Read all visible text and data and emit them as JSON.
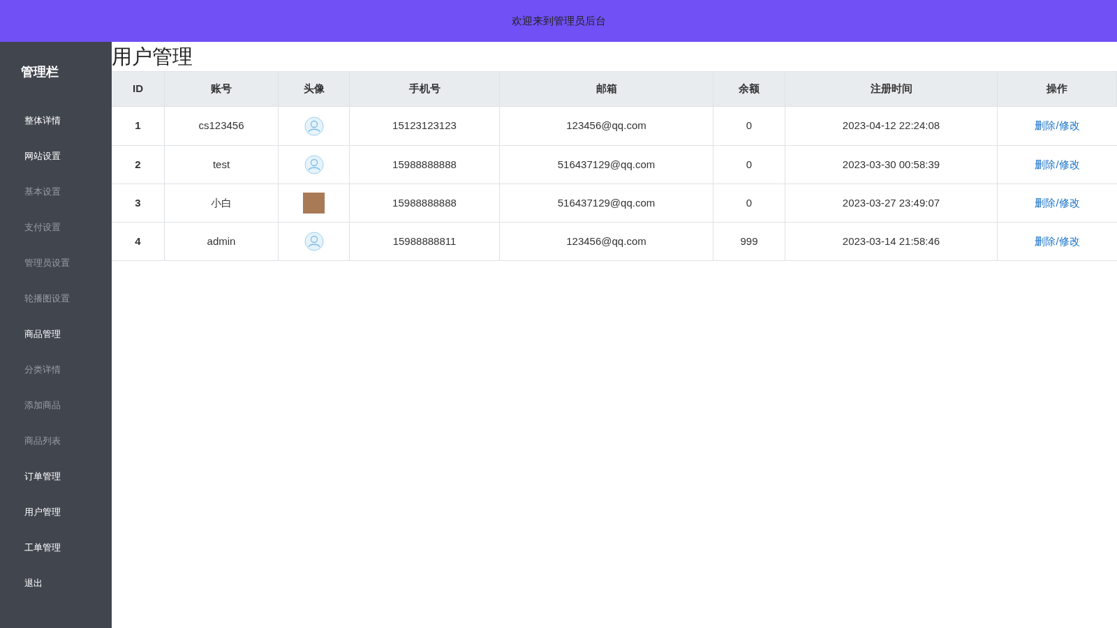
{
  "header": {
    "title": "欢迎来到管理员后台"
  },
  "sidebar": {
    "title": "管理栏",
    "items": [
      {
        "label": "整体详情",
        "kind": "section"
      },
      {
        "label": "网站设置",
        "kind": "section"
      },
      {
        "label": "基本设置",
        "kind": "sub"
      },
      {
        "label": "支付设置",
        "kind": "sub"
      },
      {
        "label": "管理员设置",
        "kind": "sub"
      },
      {
        "label": "轮播图设置",
        "kind": "sub"
      },
      {
        "label": "商品管理",
        "kind": "section"
      },
      {
        "label": "分类详情",
        "kind": "sub"
      },
      {
        "label": "添加商品",
        "kind": "sub"
      },
      {
        "label": "商品列表",
        "kind": "sub"
      },
      {
        "label": "订单管理",
        "kind": "section"
      },
      {
        "label": "用户管理",
        "kind": "section"
      },
      {
        "label": "工单管理",
        "kind": "section"
      },
      {
        "label": "退出",
        "kind": "section"
      }
    ]
  },
  "page_title": "用户管理",
  "table": {
    "columns": [
      "ID",
      "账号",
      "头像",
      "手机号",
      "邮箱",
      "余额",
      "注册时间",
      "操作"
    ],
    "rows": [
      {
        "id": "1",
        "account": "cs123456",
        "avatar": {
          "kind": "default"
        },
        "phone": "15123123123",
        "email": "123456@qq.com",
        "balance": "0",
        "registered": "2023-04-12 22:24:08",
        "action": "删除/修改"
      },
      {
        "id": "2",
        "account": "test",
        "avatar": {
          "kind": "default"
        },
        "phone": "15988888888",
        "email": "516437129@qq.com",
        "balance": "0",
        "registered": "2023-03-30 00:58:39",
        "action": "删除/修改"
      },
      {
        "id": "3",
        "account": "小白",
        "avatar": {
          "kind": "photo"
        },
        "phone": "15988888888",
        "email": "516437129@qq.com",
        "balance": "0",
        "registered": "2023-03-27 23:49:07",
        "action": "删除/修改"
      },
      {
        "id": "4",
        "account": "admin",
        "avatar": {
          "kind": "default"
        },
        "phone": "15988888811",
        "email": "123456@qq.com",
        "balance": "999",
        "registered": "2023-03-14 21:58:46",
        "action": "删除/修改"
      }
    ]
  }
}
